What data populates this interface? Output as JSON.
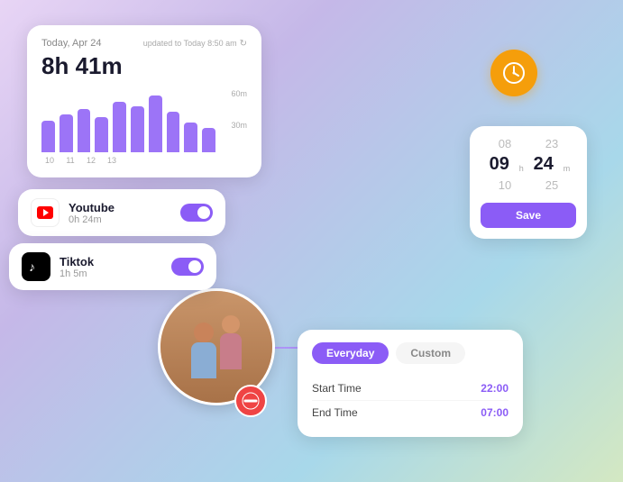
{
  "background": {
    "gradient_start": "#e8d5f5",
    "gradient_end": "#a8d8ea"
  },
  "stats_card": {
    "date_label": "Today, Apr 24",
    "updated_label": "updated to Today 8:50 am",
    "total_time": "8h 41m",
    "chart_bars": [
      45,
      55,
      60,
      50,
      70,
      65,
      80,
      58,
      42,
      35
    ],
    "y_axis": [
      "60m",
      "30m"
    ],
    "x_axis": [
      "10",
      "11",
      "12",
      "13"
    ]
  },
  "youtube_card": {
    "app_name": "Youtube",
    "app_time": "0h 24m",
    "toggle_on": true
  },
  "tiktok_card": {
    "app_name": "Tiktok",
    "app_time": "1h 5m",
    "toggle_on": true
  },
  "timepicker_card": {
    "hours_above": "08",
    "hours_active": "09",
    "hours_below": "10",
    "minutes_above": "23",
    "minutes_active": "24",
    "minutes_below": "25",
    "hour_label": "h",
    "minute_label": "m",
    "save_label": "Save"
  },
  "clock_badge": {
    "icon": "clock"
  },
  "schedule_card": {
    "tab_everyday": "Everyday",
    "tab_custom": "Custom",
    "active_tab": "everyday",
    "start_time_label": "Start Time",
    "start_time_value": "22:00",
    "end_time_label": "End Time",
    "end_time_value": "07:00"
  },
  "no_entry_icon": "⊘"
}
